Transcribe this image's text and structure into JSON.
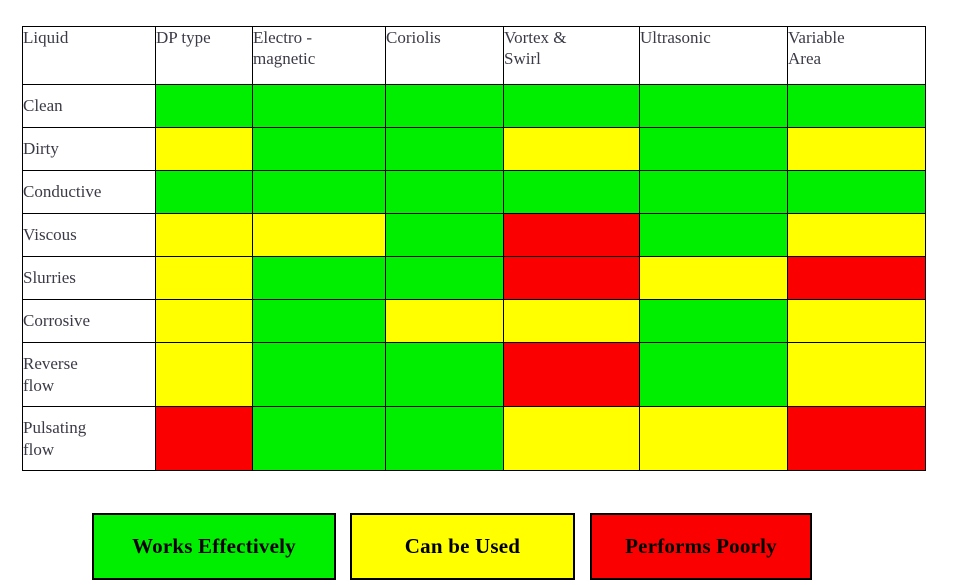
{
  "table": {
    "headers": [
      "Liquid",
      "DP type",
      "Electro -\nmagnetic",
      "Coriolis",
      "Vortex &\nSwirl",
      "Ultrasonic",
      "Variable\nArea"
    ],
    "headers_flat": [
      "Liquid",
      "DP type",
      "Electro - magnetic",
      "Coriolis",
      "Vortex & Swirl",
      "Ultrasonic",
      "Variable Area"
    ],
    "rows": [
      {
        "label": "Clean",
        "ratings": [
          "g",
          "g",
          "g",
          "g",
          "g",
          "g"
        ]
      },
      {
        "label": "Dirty",
        "ratings": [
          "y",
          "g",
          "g",
          "y",
          "g",
          "y"
        ]
      },
      {
        "label": "Conductive",
        "ratings": [
          "g",
          "g",
          "g",
          "g",
          "g",
          "g"
        ]
      },
      {
        "label": "Viscous",
        "ratings": [
          "y",
          "y",
          "g",
          "r",
          "g",
          "y"
        ]
      },
      {
        "label": "Slurries",
        "ratings": [
          "y",
          "g",
          "g",
          "r",
          "y",
          "r"
        ]
      },
      {
        "label": "Corrosive",
        "ratings": [
          "y",
          "g",
          "y",
          "y",
          "g",
          "y"
        ]
      },
      {
        "label": "Reverse\nflow",
        "ratings": [
          "y",
          "g",
          "g",
          "r",
          "g",
          "y"
        ]
      },
      {
        "label": "Pulsating\nflow",
        "ratings": [
          "r",
          "g",
          "g",
          "y",
          "y",
          "r"
        ]
      }
    ]
  },
  "legend": {
    "works": "Works Effectively",
    "can_be_used": "Can be Used",
    "performs_poorly": "Performs Poorly"
  },
  "colors": {
    "green": "#00ee00",
    "yellow": "#ffff00",
    "red": "#fa0000",
    "border": "#000000",
    "text": "#3b3b47",
    "background": "#ffffff"
  },
  "legend_key": {
    "g": "Works Effectively",
    "y": "Can be Used",
    "r": "Performs Poorly"
  }
}
